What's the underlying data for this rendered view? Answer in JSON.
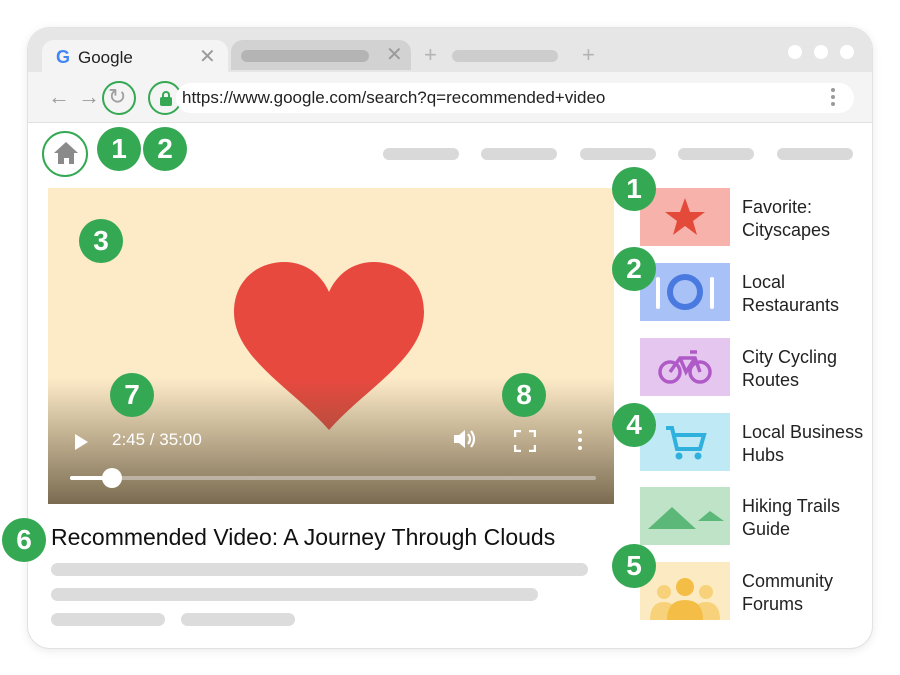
{
  "browser": {
    "tab_active": {
      "icon": "google-g-icon",
      "logo_letter": "G",
      "title": "Google",
      "close_symbol": "✕"
    },
    "tab_inactive": {
      "close_symbol": "✕"
    },
    "new_tab_symbol": "+",
    "url": "https://www.google.com/search?q=recommended+video"
  },
  "badges": {
    "reload": "1",
    "lock": "2",
    "video_area": "3",
    "rec_favorite": "1",
    "rec_restaurants": "2",
    "rec_business": "4",
    "rec_forums": "5",
    "title": "6",
    "time": "7",
    "fullscreen": "8"
  },
  "player": {
    "time": "2:45 / 35:00",
    "progress": 0.08
  },
  "video_title": "Recommended Video: A Journey Through Clouds",
  "recommendations": [
    {
      "line1": "Favorite:",
      "line2": "Cityscapes",
      "icon": "star-icon",
      "color": "#f7b3ab"
    },
    {
      "line1": "Local",
      "line2": "Restaurants",
      "icon": "utensils-icon",
      "color": "#a8c2f7"
    },
    {
      "line1": "City Cycling",
      "line2": "Routes",
      "icon": "bicycle-icon",
      "color": "#e4c6ef"
    },
    {
      "line1": "Local Business",
      "line2": "Hubs",
      "icon": "cart-icon",
      "color": "#bfe9f4"
    },
    {
      "line1": "Hiking Trails",
      "line2": "Guide",
      "icon": "mountains-icon",
      "color": "#bfe3c6"
    },
    {
      "line1": "Community",
      "line2": "Forums",
      "icon": "people-icon",
      "color": "#fcebc2"
    }
  ],
  "colors": {
    "badge": "#34a853",
    "heart": "#e8493f",
    "video_bg": "#fdebc8"
  }
}
